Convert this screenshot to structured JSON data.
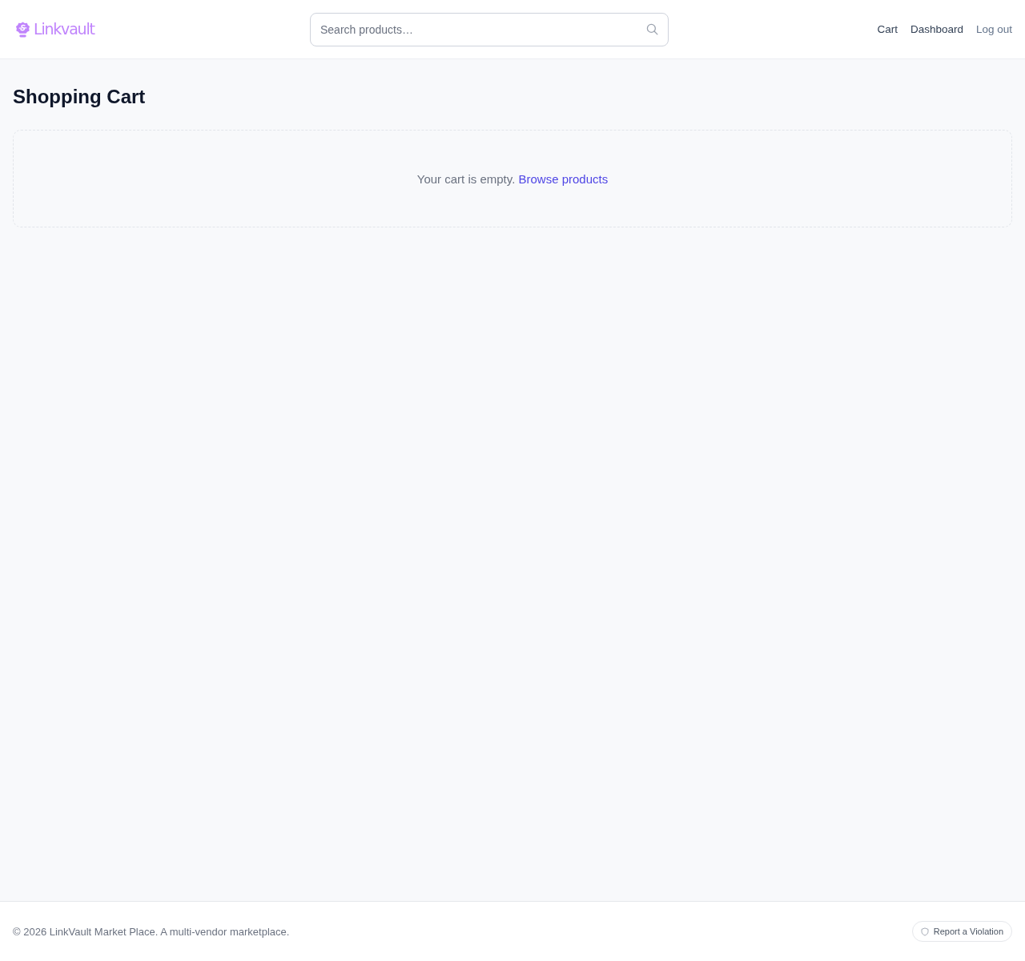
{
  "header": {
    "logo": "Linkvault",
    "search": {
      "placeholder": "Search products…"
    },
    "nav": [
      {
        "label": "Cart",
        "kind": "link"
      },
      {
        "label": "Dashboard",
        "kind": "link"
      },
      {
        "label": "Log out",
        "kind": "button"
      }
    ]
  },
  "page": {
    "title": "Shopping Cart",
    "empty_message": {
      "text": "Your cart is empty.",
      "link": "Browse products"
    }
  },
  "footer": {
    "copyright": "© 2026 LinkVault Market Place. A multi-vendor marketplace.",
    "report_button": "Report a Violation"
  }
}
